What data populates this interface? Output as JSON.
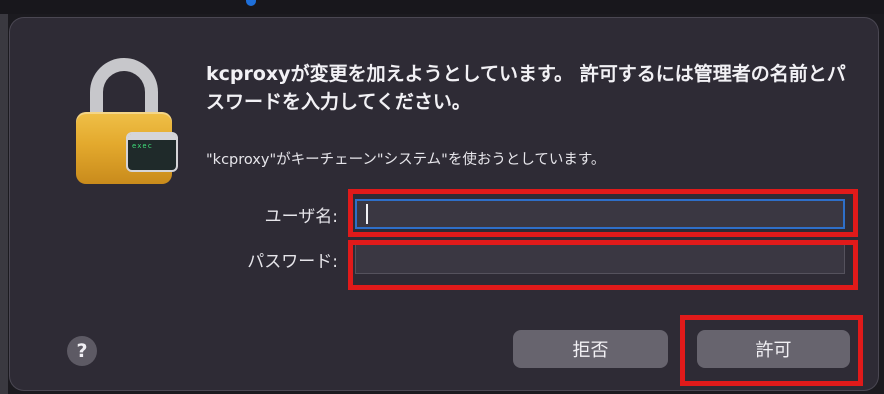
{
  "dialog": {
    "title": "kcproxyが変更を加えようとしています。 許可するには管理者の名前とパスワードを入力してください。",
    "subtitle": "\"kcproxy\"がキーチェーン\"システム\"を使おうとしています。",
    "username_label": "ユーザ名:",
    "username_value": "",
    "password_label": "パスワード:",
    "password_value": "",
    "help_label": "?",
    "deny_label": "拒否",
    "allow_label": "許可",
    "icon": "lock-icon",
    "badge_icon": "terminal-icon",
    "badge_text": "exec"
  },
  "colors": {
    "dialog_bg": "#2e2b35",
    "button_bg": "#67646e",
    "focus_ring": "#2e6fc9",
    "highlight": "#e01a1a",
    "lock_gold": "#e3a92d"
  }
}
